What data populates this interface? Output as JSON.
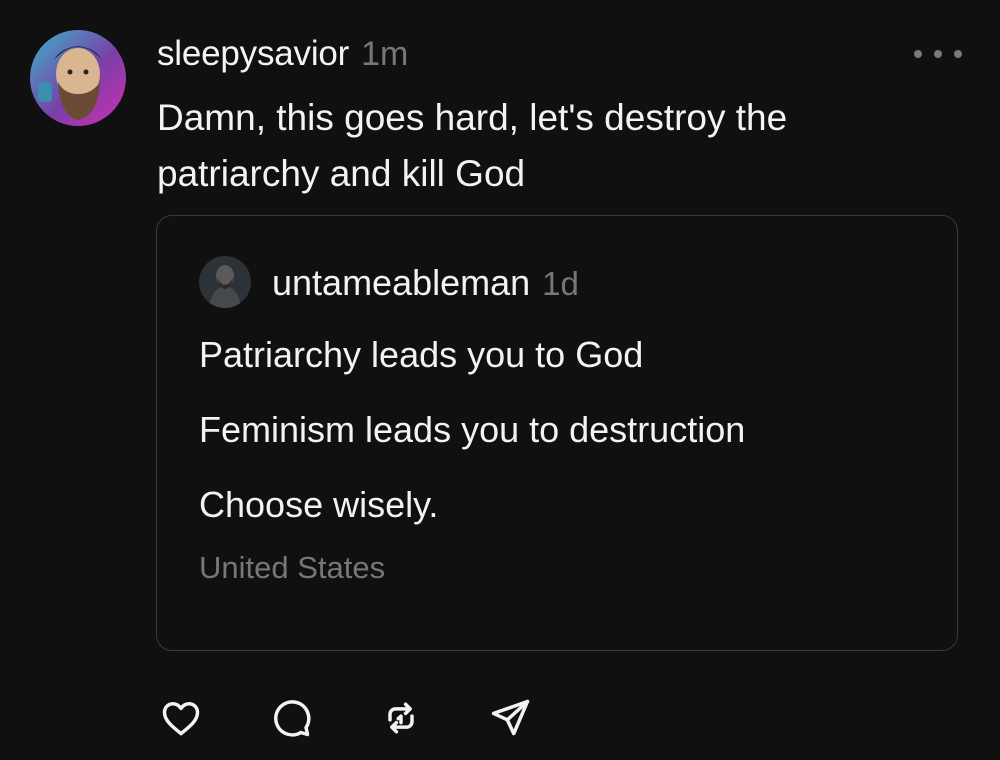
{
  "post": {
    "author": "sleepysavior",
    "time": "1m",
    "text": "Damn, this goes hard, let's destroy the\npatriarchy and kill God"
  },
  "quoted_post": {
    "author": "untameableman",
    "time": "1d",
    "lines": [
      "Patriarchy leads you to God",
      "Feminism leads you to destruction",
      "Choose wisely."
    ],
    "location": "United States"
  },
  "actions": [
    "heart-icon",
    "comment-icon",
    "repost-icon",
    "share-icon"
  ],
  "colors": {
    "background": "#101010",
    "text": "#f3f3f3",
    "muted": "#777777",
    "border": "#3a3a3a"
  }
}
